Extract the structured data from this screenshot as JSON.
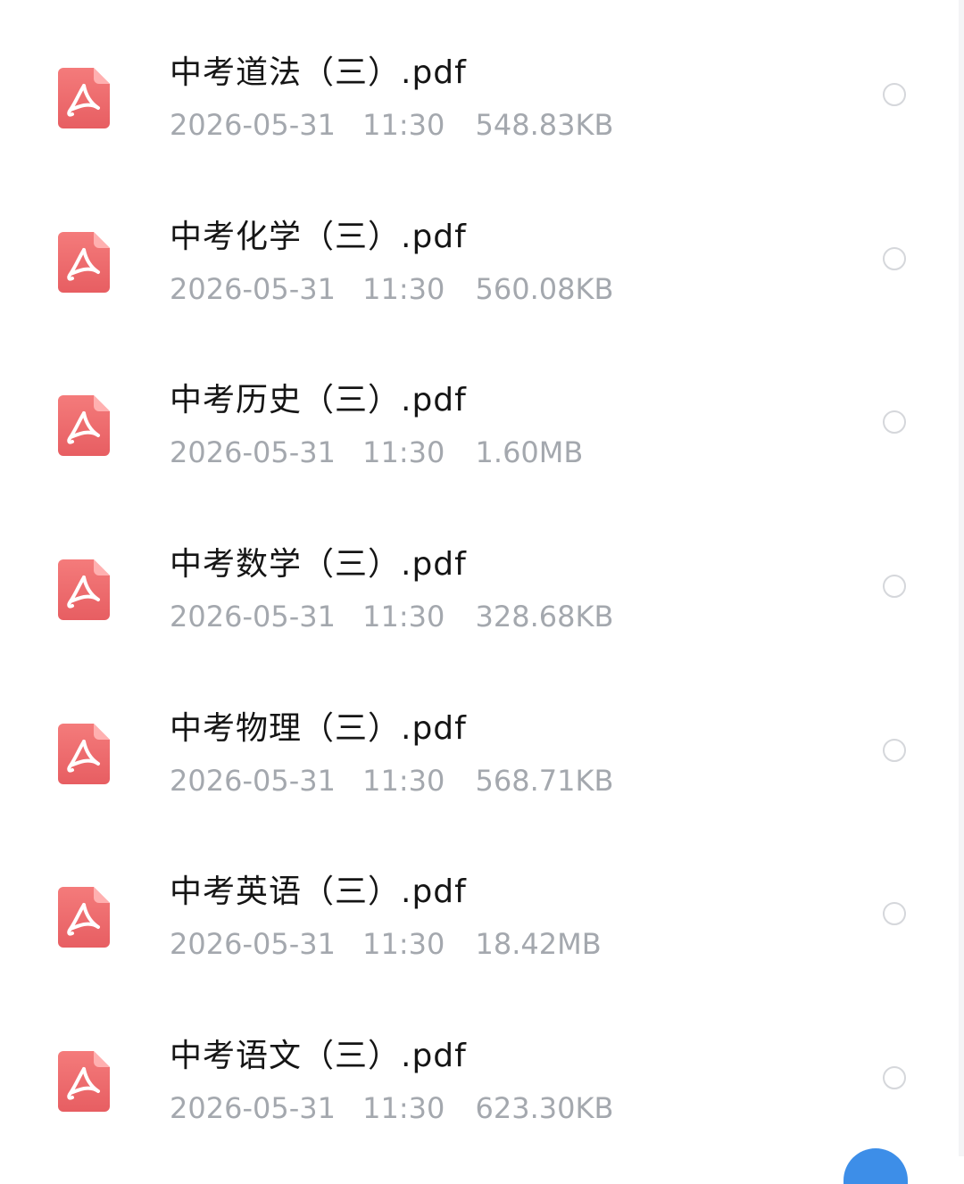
{
  "files": [
    {
      "name": "中考道法（三）.pdf",
      "date": "2026-05-31",
      "time": "11:30",
      "size": "548.83KB",
      "icon": "pdf-file-icon",
      "selected": false
    },
    {
      "name": "中考化学（三）.pdf",
      "date": "2026-05-31",
      "time": "11:30",
      "size": "560.08KB",
      "icon": "pdf-file-icon",
      "selected": false
    },
    {
      "name": "中考历史（三）.pdf",
      "date": "2026-05-31",
      "time": "11:30",
      "size": "1.60MB",
      "icon": "pdf-file-icon",
      "selected": false
    },
    {
      "name": "中考数学（三）.pdf",
      "date": "2026-05-31",
      "time": "11:30",
      "size": "328.68KB",
      "icon": "pdf-file-icon",
      "selected": false
    },
    {
      "name": "中考物理（三）.pdf",
      "date": "2026-05-31",
      "time": "11:30",
      "size": "568.71KB",
      "icon": "pdf-file-icon",
      "selected": false
    },
    {
      "name": "中考英语（三）.pdf",
      "date": "2026-05-31",
      "time": "11:30",
      "size": "18.42MB",
      "icon": "pdf-file-icon",
      "selected": false
    },
    {
      "name": "中考语文（三）.pdf",
      "date": "2026-05-31",
      "time": "11:30",
      "size": "623.30KB",
      "icon": "pdf-file-icon",
      "selected": false
    }
  ],
  "colors": {
    "pdf_icon_top": "#f47b7b",
    "pdf_icon_bottom": "#e75e62",
    "title_text": "#151515",
    "meta_text": "#a4a8ae",
    "radio_border": "#d5d7db",
    "fab": "#3d8ee8"
  }
}
